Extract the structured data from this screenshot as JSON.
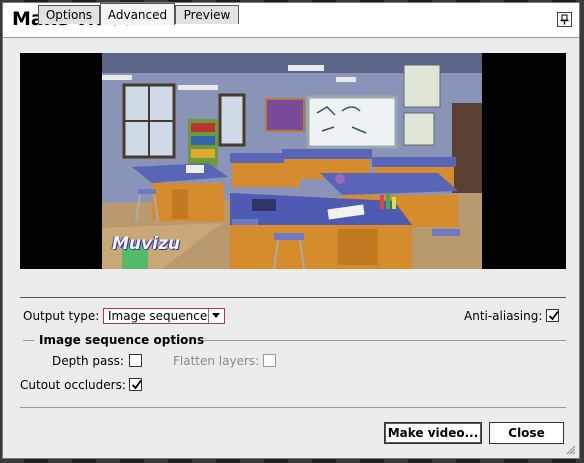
{
  "dialog": {
    "title": "Make video",
    "pin_icon": "pin-icon"
  },
  "preview": {
    "watermark": "Muvizu",
    "scene": "classroom-science-lab"
  },
  "tabs": [
    {
      "label": "Options",
      "active": false
    },
    {
      "label": "Advanced",
      "active": true
    },
    {
      "label": "Preview",
      "active": false
    }
  ],
  "advanced": {
    "output_type_label": "Output type:",
    "output_type_value": "Image sequence",
    "antialiasing_label": "Anti-aliasing:",
    "antialiasing_checked": true,
    "section_title": "Image sequence options",
    "depth_pass_label": "Depth pass:",
    "depth_pass_checked": false,
    "flatten_layers_label": "Flatten layers:",
    "flatten_layers_checked": false,
    "flatten_layers_enabled": false,
    "cutout_occluders_label": "Cutout occluders:",
    "cutout_occluders_checked": true
  },
  "buttons": {
    "make_video": "Make video...",
    "close": "Close"
  },
  "colors": {
    "combo_border": "#c0305a",
    "dialog_bg": "#ececec"
  }
}
